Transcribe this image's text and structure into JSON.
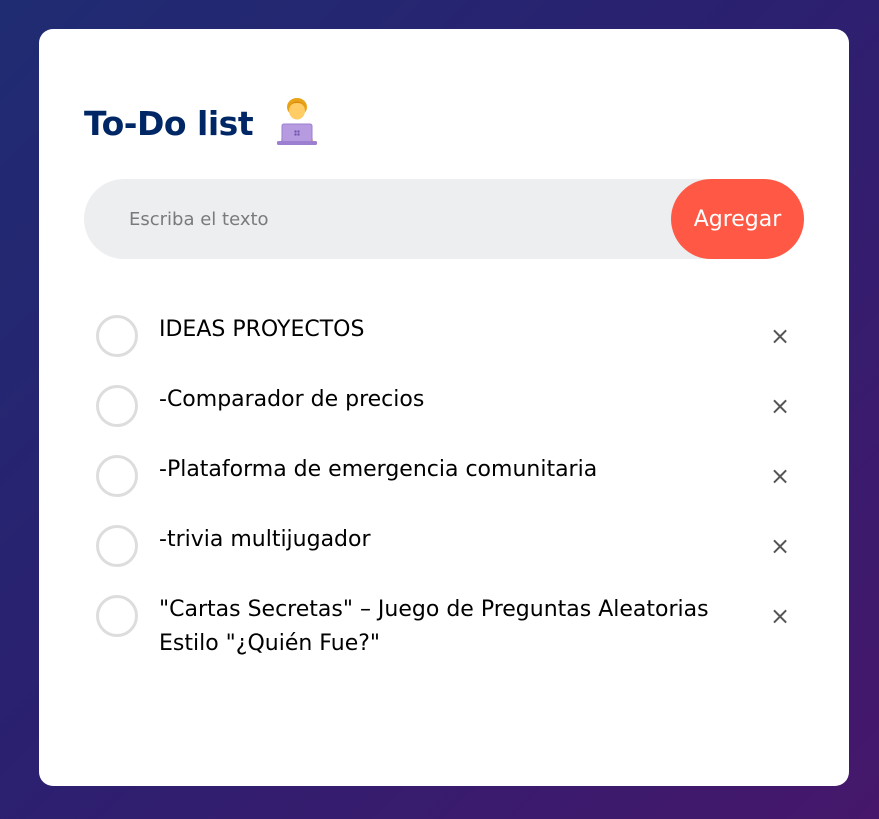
{
  "header": {
    "title": "To-Do list",
    "icon": "person-with-laptop-icon"
  },
  "input": {
    "placeholder": "Escriba el texto",
    "value": "",
    "add_label": "Agregar"
  },
  "colors": {
    "title": "#002765",
    "accent": "#ff5945",
    "input_bg": "#edeef0",
    "background_start": "#1f2c72",
    "background_end": "#46176b"
  },
  "tasks": [
    {
      "text": "IDEAS PROYECTOS",
      "checked": false
    },
    {
      "text": "-Comparador de precios",
      "checked": false
    },
    {
      "text": "-Plataforma de emergencia comunitaria",
      "checked": false
    },
    {
      "text": "-trivia multijugador",
      "checked": false
    },
    {
      "text": "\"Cartas Secretas\" – Juego de Preguntas Aleatorias Estilo \"¿Quién Fue?\"",
      "checked": false
    }
  ],
  "delete_symbol": "×"
}
